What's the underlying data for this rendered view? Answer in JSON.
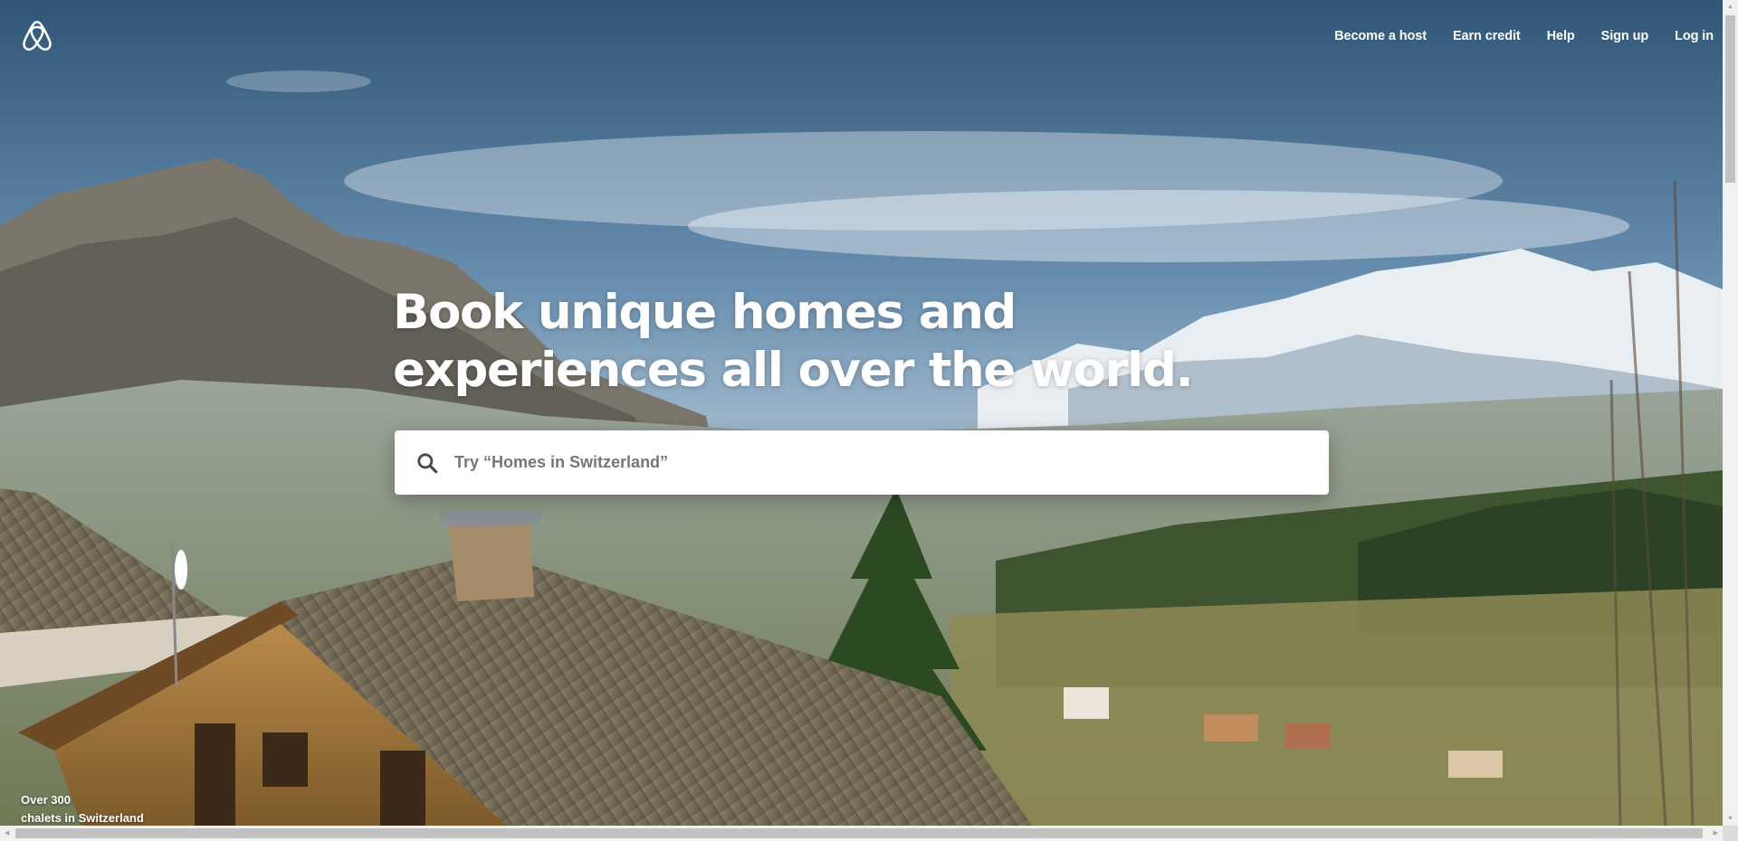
{
  "brand": {
    "logo_icon": "airbnb-belo-icon",
    "color": "#ffffff"
  },
  "nav": {
    "items": [
      {
        "label": "Become a host"
      },
      {
        "label": "Earn credit"
      },
      {
        "label": "Help"
      },
      {
        "label": "Sign up"
      },
      {
        "label": "Log in"
      }
    ]
  },
  "hero": {
    "headline_line1": "Book unique homes and",
    "headline_line2": "experiences all over the world.",
    "caption_line1": "Over 300",
    "caption_line2": "chalets in Switzerland"
  },
  "search": {
    "icon": "search-icon",
    "value": "",
    "placeholder": "Try “Homes in Switzerland”"
  }
}
